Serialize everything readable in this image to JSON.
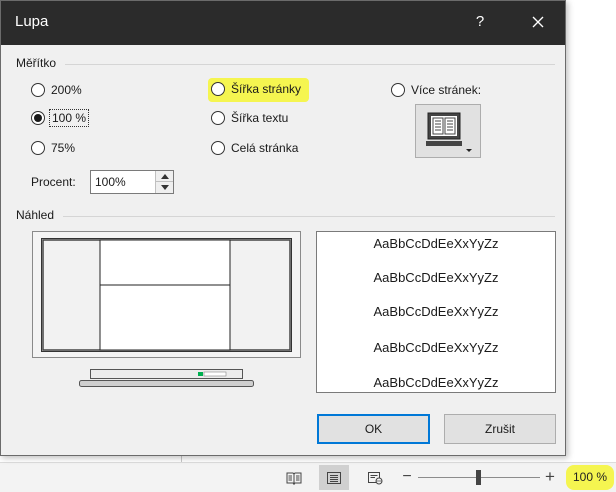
{
  "dialog": {
    "title": "Lupa",
    "help_symbol": "?",
    "close_icon": "close-icon"
  },
  "scale_group": {
    "label": "Měřítko",
    "options": [
      {
        "label": "200%",
        "selected": false
      },
      {
        "label": "100 %",
        "selected": true
      },
      {
        "label": "75%",
        "selected": false
      },
      {
        "label": "Šířka stránky",
        "selected": false,
        "highlighted": true
      },
      {
        "label": "Šířka textu",
        "selected": false
      },
      {
        "label": "Celá stránka",
        "selected": false
      },
      {
        "label": "Více stránek:",
        "selected": false
      }
    ],
    "multipage_icon": "monitor-pages-icon",
    "percent_label": "Procent:",
    "percent_value": "100%"
  },
  "preview_group": {
    "label": "Náhled",
    "sample_text": [
      "AaBbCcDdEeXxYyZz",
      "AaBbCcDdEeXxYyZz",
      "AaBbCcDdEeXxYyZz",
      "AaBbCcDdEeXxYyZz",
      "AaBbCcDdEeXxYyZz"
    ]
  },
  "buttons": {
    "ok": "OK",
    "cancel": "Zrušit"
  },
  "statusbar": {
    "view_icons": [
      "read-mode-icon",
      "print-layout-icon",
      "web-layout-icon"
    ],
    "active_view": "print-layout-icon",
    "zoom_out": "−",
    "zoom_in": "+",
    "zoom_percent": "100 %",
    "zoom_level_percent": 100
  },
  "colors": {
    "highlight": "#f5f550",
    "titlebar": "#2b2b2b",
    "focus_border": "#0078d7"
  }
}
